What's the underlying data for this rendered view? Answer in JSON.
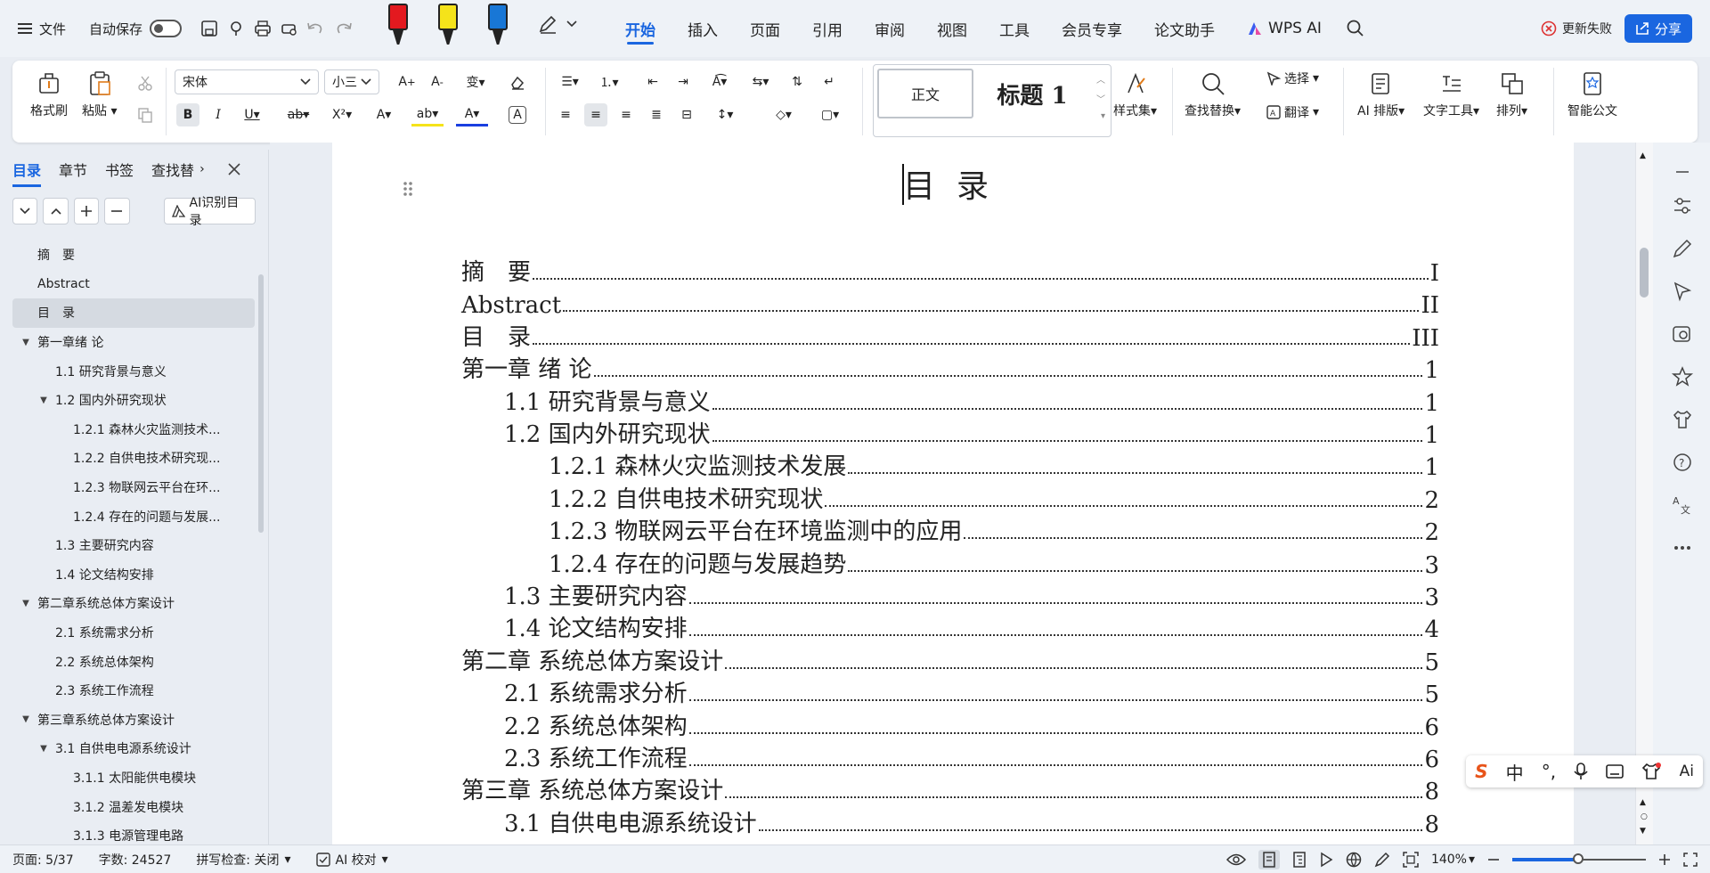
{
  "topbar": {
    "file_label": "文件",
    "autosave_label": "自动保存",
    "tabs": [
      "开始",
      "插入",
      "页面",
      "引用",
      "审阅",
      "视图",
      "工具",
      "会员专享",
      "论文助手",
      "WPS AI"
    ],
    "active_tab": "开始",
    "restore_label": "更新失败",
    "share_label": "分享",
    "pen_colors": [
      "#e3191f",
      "#f5e31a",
      "#1877d6"
    ]
  },
  "ribbon": {
    "format_painter": "格式刷",
    "paste": "粘贴",
    "font_name": "宋体",
    "font_size": "小三",
    "style_normal": "正文",
    "style_h1": "标题 1",
    "style_set": "样式集",
    "find_replace": "查找替换",
    "select": "选择",
    "translate": "翻译",
    "ai_layout": "AI 排版",
    "text_tools": "文字工具",
    "arrange": "排列",
    "smart_doc": "智能公文"
  },
  "sidebar": {
    "tabs": [
      "目录",
      "章节",
      "书签",
      "查找替"
    ],
    "active_tab": "目录",
    "ai_toc_label": "AI识别目录",
    "items": [
      {
        "label": "摘　要",
        "level": 0,
        "arrow": ""
      },
      {
        "label": "Abstract",
        "level": 0,
        "arrow": ""
      },
      {
        "label": "目　录",
        "level": 0,
        "arrow": "",
        "selected": true
      },
      {
        "label": "第一章绪 论",
        "level": 0,
        "arrow": "▼"
      },
      {
        "label": "1.1 研究背景与意义",
        "level": 1,
        "arrow": ""
      },
      {
        "label": "1.2 国内外研究现状",
        "level": 1,
        "arrow": "▼"
      },
      {
        "label": "1.2.1 森林火灾监测技术...",
        "level": 2,
        "arrow": ""
      },
      {
        "label": "1.2.2 自供电技术研究现...",
        "level": 2,
        "arrow": ""
      },
      {
        "label": "1.2.3 物联网云平台在环...",
        "level": 2,
        "arrow": ""
      },
      {
        "label": "1.2.4 存在的问题与发展...",
        "level": 2,
        "arrow": ""
      },
      {
        "label": "1.3 主要研究内容",
        "level": 1,
        "arrow": ""
      },
      {
        "label": "1.4 论文结构安排",
        "level": 1,
        "arrow": ""
      },
      {
        "label": "第二章系统总体方案设计",
        "level": 0,
        "arrow": "▼"
      },
      {
        "label": "2.1 系统需求分析",
        "level": 1,
        "arrow": ""
      },
      {
        "label": "2.2 系统总体架构",
        "level": 1,
        "arrow": ""
      },
      {
        "label": "2.3 系统工作流程",
        "level": 1,
        "arrow": ""
      },
      {
        "label": "第三章系统总体方案设计",
        "level": 0,
        "arrow": "▼"
      },
      {
        "label": "3.1 自供电电源系统设计",
        "level": 1,
        "arrow": "▼"
      },
      {
        "label": "3.1.1 太阳能供电模块",
        "level": 2,
        "arrow": ""
      },
      {
        "label": "3.1.2 温差发电模块",
        "level": 2,
        "arrow": ""
      },
      {
        "label": "3.1.3 电源管理电路",
        "level": 2,
        "arrow": ""
      }
    ]
  },
  "document": {
    "title": "目录",
    "toc": [
      {
        "text": "摘　要",
        "page": "I",
        "level": 0
      },
      {
        "text": "Abstract",
        "page": "II",
        "level": 0
      },
      {
        "text": "目　录",
        "page": "III",
        "level": 0
      },
      {
        "text": "第一章  绪  论",
        "page": "1",
        "level": 0
      },
      {
        "text": "1.1  研究背景与意义",
        "page": "1",
        "level": 1
      },
      {
        "text": "1.2  国内外研究现状",
        "page": "1",
        "level": 1
      },
      {
        "text": "1.2.1  森林火灾监测技术发展",
        "page": "1",
        "level": 2
      },
      {
        "text": "1.2.2  自供电技术研究现状",
        "page": "2",
        "level": 2
      },
      {
        "text": "1.2.3  物联网云平台在环境监测中的应用",
        "page": "2",
        "level": 2
      },
      {
        "text": "1.2.4  存在的问题与发展趋势",
        "page": "3",
        "level": 2
      },
      {
        "text": "1.3  主要研究内容",
        "page": "3",
        "level": 1
      },
      {
        "text": "1.4  论文结构安排",
        "page": "4",
        "level": 1
      },
      {
        "text": "第二章  系统总体方案设计",
        "page": "5",
        "level": 0
      },
      {
        "text": "2.1  系统需求分析",
        "page": "5",
        "level": 1
      },
      {
        "text": "2.2  系统总体架构",
        "page": "6",
        "level": 1
      },
      {
        "text": "2.3  系统工作流程",
        "page": "6",
        "level": 1
      },
      {
        "text": "第三章  系统总体方案设计",
        "page": "8",
        "level": 0
      },
      {
        "text": "3.1  自供电电源系统设计",
        "page": "8",
        "level": 1
      }
    ]
  },
  "status": {
    "page": "页面: 5/37",
    "word_count": "字数: 24527",
    "spell_check": "拼写检查: 关闭",
    "ai_proof": "AI 校对",
    "zoom": "140%"
  },
  "ime": {
    "logo": "S",
    "mode": "中",
    "ai": "Ai"
  },
  "colors": {
    "accent": "#1a66e0",
    "background": "#e9edf3"
  }
}
